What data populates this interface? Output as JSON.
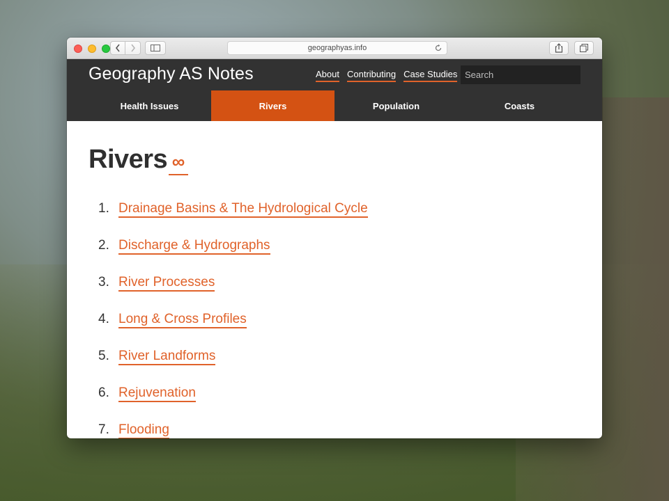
{
  "browser": {
    "url": "geographyas.info"
  },
  "site": {
    "title": "Geography AS Notes",
    "top_links": [
      "About",
      "Contributing",
      "Case Studies"
    ],
    "search_placeholder": "Search",
    "tabs": [
      "Health Issues",
      "Rivers",
      "Population",
      "Coasts"
    ],
    "active_tab": "Rivers"
  },
  "page": {
    "heading": "Rivers",
    "permalink_glyph": "∞",
    "items": [
      {
        "num": "1.",
        "label": "Drainage Basins & The Hydrological Cycle"
      },
      {
        "num": "2.",
        "label": "Discharge & Hydrographs"
      },
      {
        "num": "3.",
        "label": "River Processes"
      },
      {
        "num": "4.",
        "label": "Long & Cross Profiles"
      },
      {
        "num": "5.",
        "label": "River Landforms"
      },
      {
        "num": "6.",
        "label": "Rejuvenation"
      },
      {
        "num": "7.",
        "label": "Flooding"
      }
    ]
  },
  "colors": {
    "accent": "#e0622a",
    "active_tab": "#d45213",
    "header_bg": "#323232"
  }
}
